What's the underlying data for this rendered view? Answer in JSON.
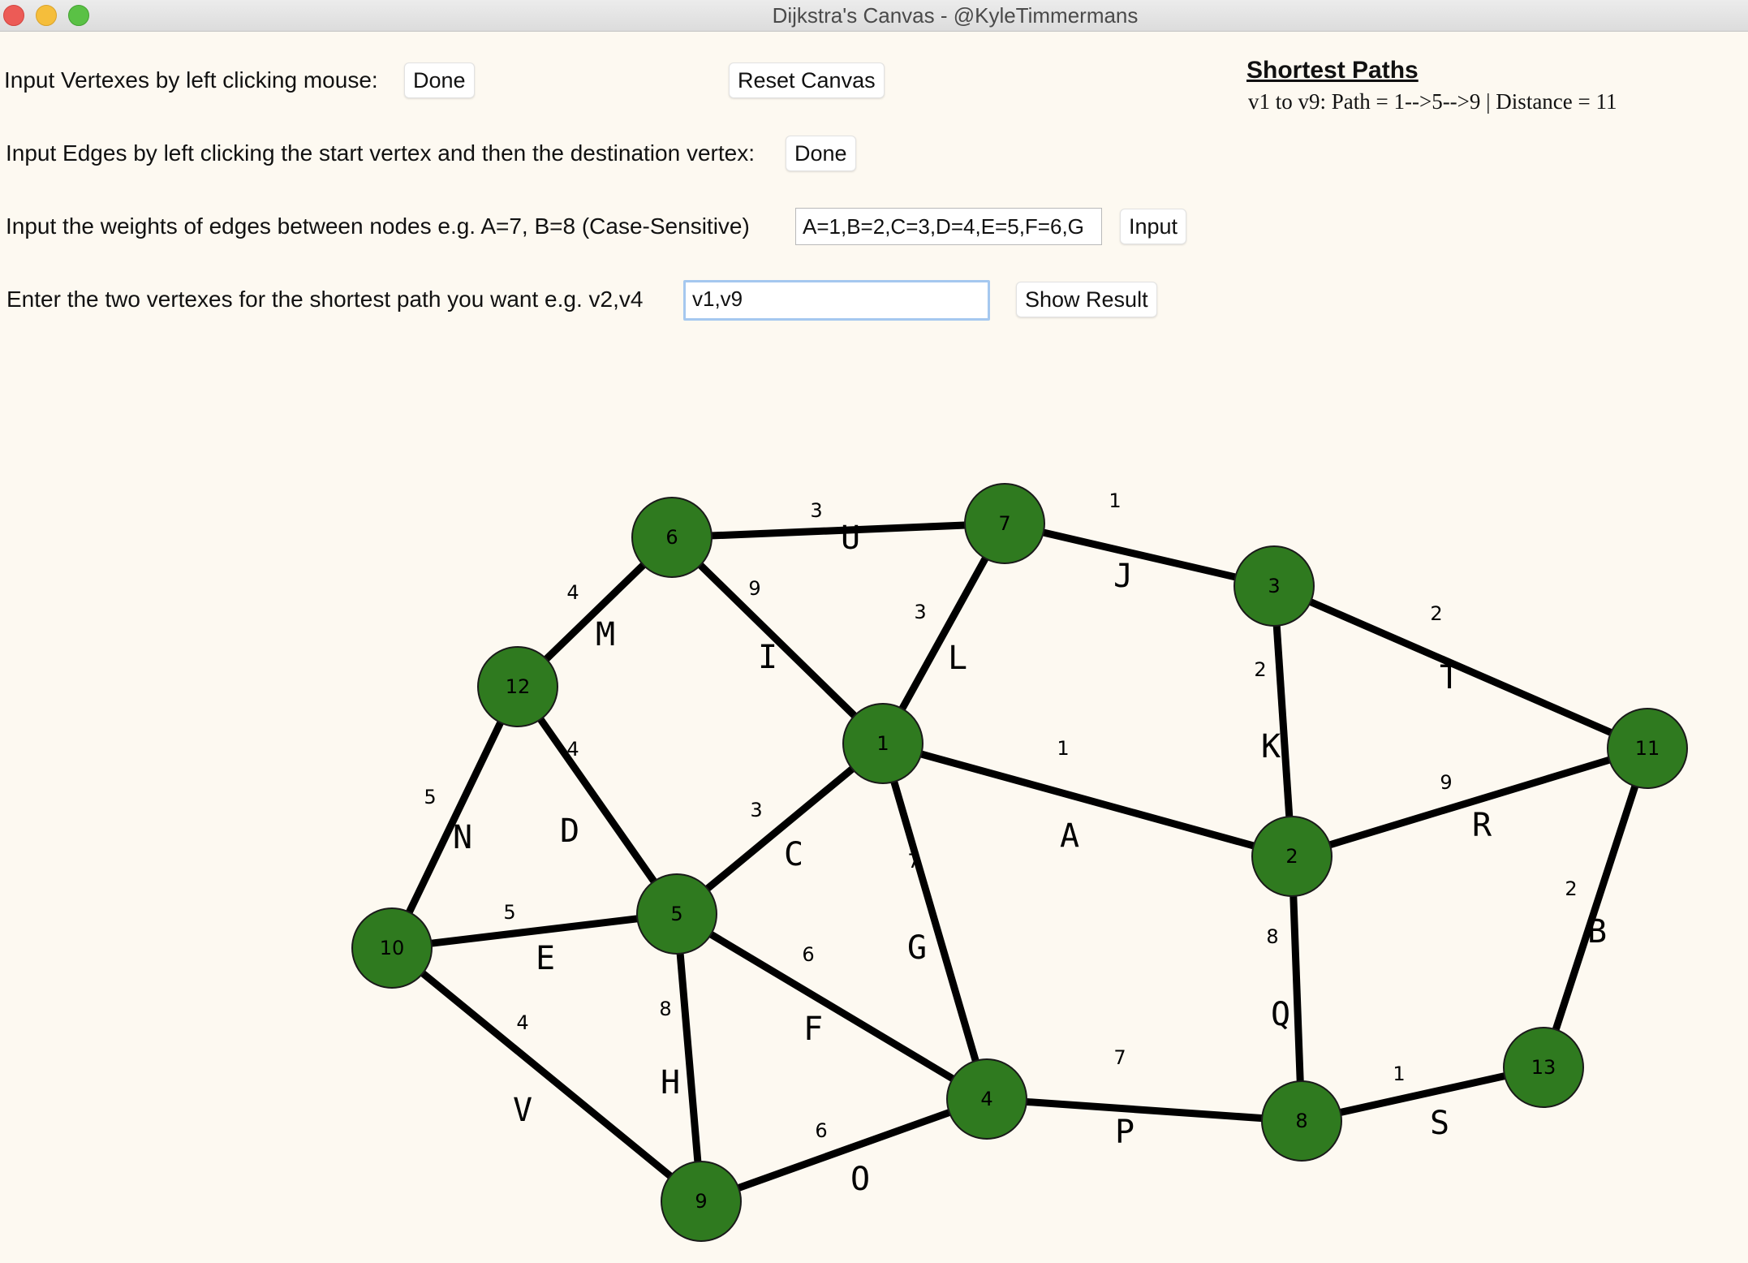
{
  "window": {
    "title": "Dijkstra's Canvas - @KyleTimmermans"
  },
  "controls": {
    "vertex_instruction": "Input Vertexes by left clicking mouse:",
    "vertex_done": "Done",
    "reset_label": "Reset Canvas",
    "edge_instruction": "Input Edges by left clicking the start vertex and then the destination vertex:",
    "edge_done": "Done",
    "weights_instruction": "Input the weights of edges between nodes e.g. A=7, B=8 (Case-Sensitive)",
    "weights_value": "A=1,B=2,C=3,D=4,E=5,F=6,G",
    "weights_button": "Input",
    "path_instruction": "Enter the two vertexes for the shortest path you want e.g. v2,v4",
    "path_value": "v1,v9",
    "show_result": "Show Result"
  },
  "results": {
    "heading": "Shortest Paths",
    "line": "v1 to v9: Path = 1-->5-->9 | Distance = 11"
  },
  "graph": {
    "node_color": "#2f7a1f",
    "nodes": [
      "6",
      "7",
      "3",
      "12",
      "1",
      "11",
      "2",
      "10",
      "5",
      "4",
      "8",
      "13",
      "9"
    ],
    "edges": [
      {
        "letter": "A",
        "weight": "1"
      },
      {
        "letter": "B",
        "weight": "2"
      },
      {
        "letter": "C",
        "weight": "3"
      },
      {
        "letter": "D",
        "weight": "4"
      },
      {
        "letter": "E",
        "weight": "5"
      },
      {
        "letter": "F",
        "weight": "6"
      },
      {
        "letter": "G",
        "weight": "7"
      },
      {
        "letter": "H",
        "weight": "8"
      },
      {
        "letter": "I",
        "weight": "9"
      },
      {
        "letter": "J",
        "weight": "1"
      },
      {
        "letter": "K",
        "weight": "2"
      },
      {
        "letter": "L",
        "weight": "3"
      },
      {
        "letter": "M",
        "weight": "4"
      },
      {
        "letter": "N",
        "weight": "5"
      },
      {
        "letter": "O",
        "weight": "6"
      },
      {
        "letter": "P",
        "weight": "7"
      },
      {
        "letter": "Q",
        "weight": "8"
      },
      {
        "letter": "R",
        "weight": "9"
      },
      {
        "letter": "S",
        "weight": "1"
      },
      {
        "letter": "T",
        "weight": "2"
      },
      {
        "letter": "U",
        "weight": "3"
      },
      {
        "letter": "V",
        "weight": "4"
      }
    ]
  }
}
